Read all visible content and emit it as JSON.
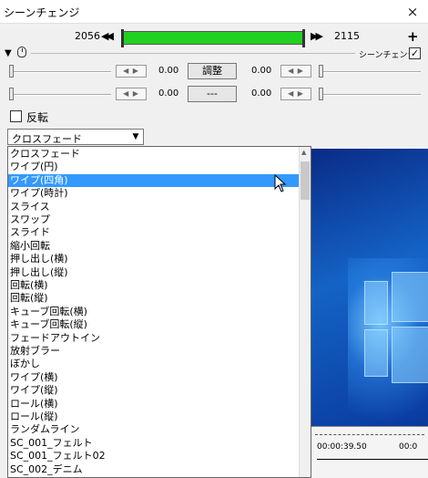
{
  "window": {
    "title": "シーンチェンジ",
    "close_label": "×"
  },
  "frames": {
    "start": "2056",
    "end": "2115"
  },
  "toolbar": {
    "prev_icon": "◀◀",
    "next_icon": "▶▶",
    "add_label": "+"
  },
  "scene_change": {
    "label": "シーンチェンジ",
    "checked": "✓"
  },
  "sliders": {
    "left_top_value": "0.00",
    "left_bottom_value": "0.00",
    "right_top_value": "0.00",
    "right_bottom_value": "0.00",
    "spin_label": "◀ ▶"
  },
  "buttons": {
    "adjust": "調整",
    "dots": "---"
  },
  "flip": {
    "label": "反転"
  },
  "transition": {
    "selected": "クロスフェード",
    "highlighted_index": 2,
    "options": [
      "クロスフェード",
      "ワイプ(円)",
      "ワイプ(四角)",
      "ワイプ(時計)",
      "スライス",
      "スワップ",
      "スライド",
      "縮小回転",
      "押し出し(横)",
      "押し出し(縦)",
      "回転(横)",
      "回転(縦)",
      "キューブ回転(横)",
      "キューブ回転(縦)",
      "フェードアウトイン",
      "放射ブラー",
      "ぼかし",
      "ワイプ(横)",
      "ワイプ(縦)",
      "ロール(横)",
      "ロール(縦)",
      "ランダムライン",
      "SC_001_フェルト",
      "SC_001_フェルト02",
      "SC_002_デニム"
    ]
  },
  "timeline": {
    "time1": "00:00:39.50",
    "time2": "00:0"
  },
  "colors": {
    "range_bar": "#22d022",
    "highlight": "#3399ff"
  },
  "icons": [
    "close-icon",
    "prev-icon",
    "next-icon",
    "plus-icon",
    "mouse-icon",
    "collapse-arrow-icon",
    "dropdown-arrow-icon",
    "cursor-icon"
  ]
}
